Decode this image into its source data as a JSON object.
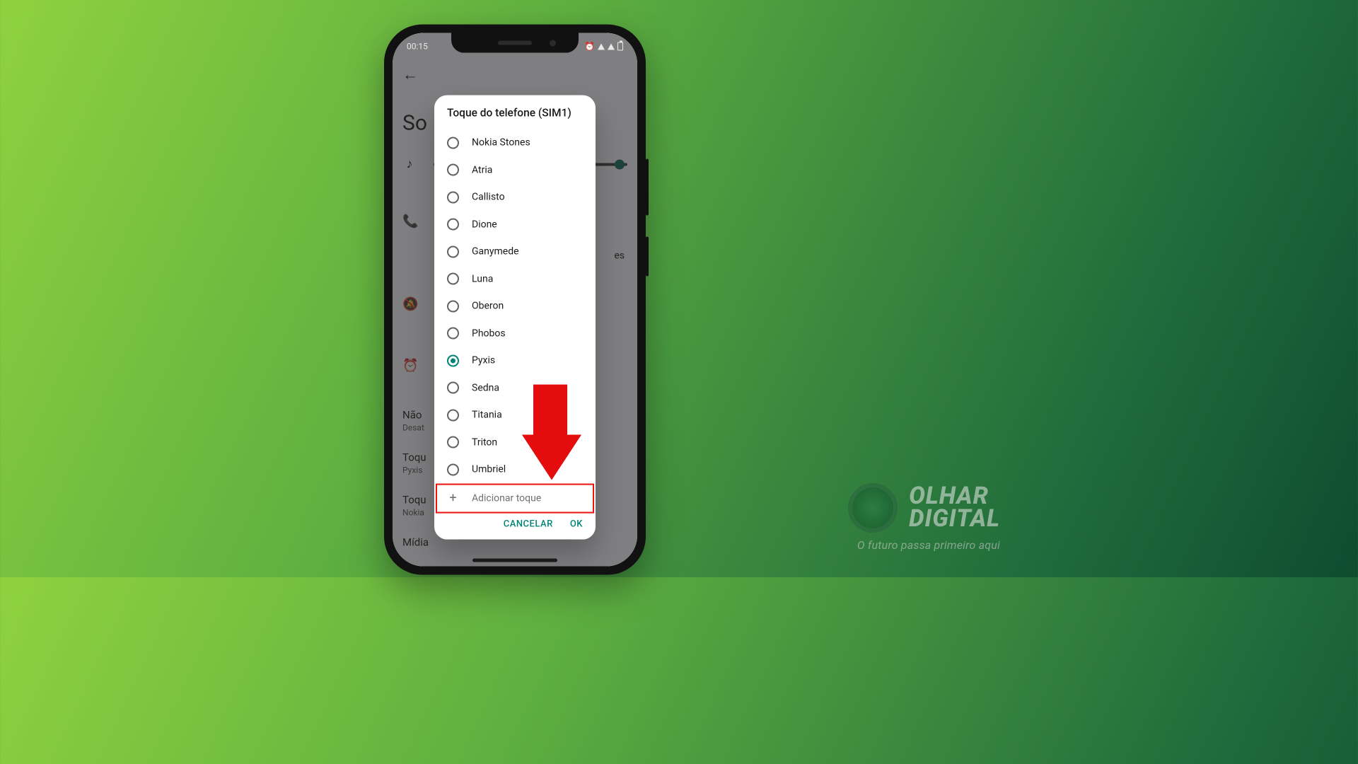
{
  "statusbar": {
    "time": "00:15"
  },
  "background_page": {
    "title_fragment": "So",
    "sections": {
      "dnd": {
        "title": "Não",
        "subtitle": "Desat"
      },
      "ringtone1": {
        "title": "Toqu",
        "subtitle": "Pyxis"
      },
      "ringtone2": {
        "title": "Toqu",
        "subtitle": "Nokia"
      },
      "media": {
        "title": "Mídia"
      }
    },
    "right_fragment": "es"
  },
  "dialog": {
    "title": "Toque do telefone (SIM1)",
    "ringtones": [
      {
        "label": "Nokia Stones",
        "selected": false
      },
      {
        "label": "Atria",
        "selected": false
      },
      {
        "label": "Callisto",
        "selected": false
      },
      {
        "label": "Dione",
        "selected": false
      },
      {
        "label": "Ganymede",
        "selected": false
      },
      {
        "label": "Luna",
        "selected": false
      },
      {
        "label": "Oberon",
        "selected": false
      },
      {
        "label": "Phobos",
        "selected": false
      },
      {
        "label": "Pyxis",
        "selected": true
      },
      {
        "label": "Sedna",
        "selected": false
      },
      {
        "label": "Titania",
        "selected": false
      },
      {
        "label": "Triton",
        "selected": false
      },
      {
        "label": "Umbriel",
        "selected": false
      }
    ],
    "add_label": "Adicionar toque",
    "actions": {
      "cancel": "CANCELAR",
      "ok": "OK"
    }
  },
  "watermark": {
    "line1": "OLHAR",
    "line2": "DIGITAL",
    "tagline": "O futuro passa primeiro aqui"
  }
}
